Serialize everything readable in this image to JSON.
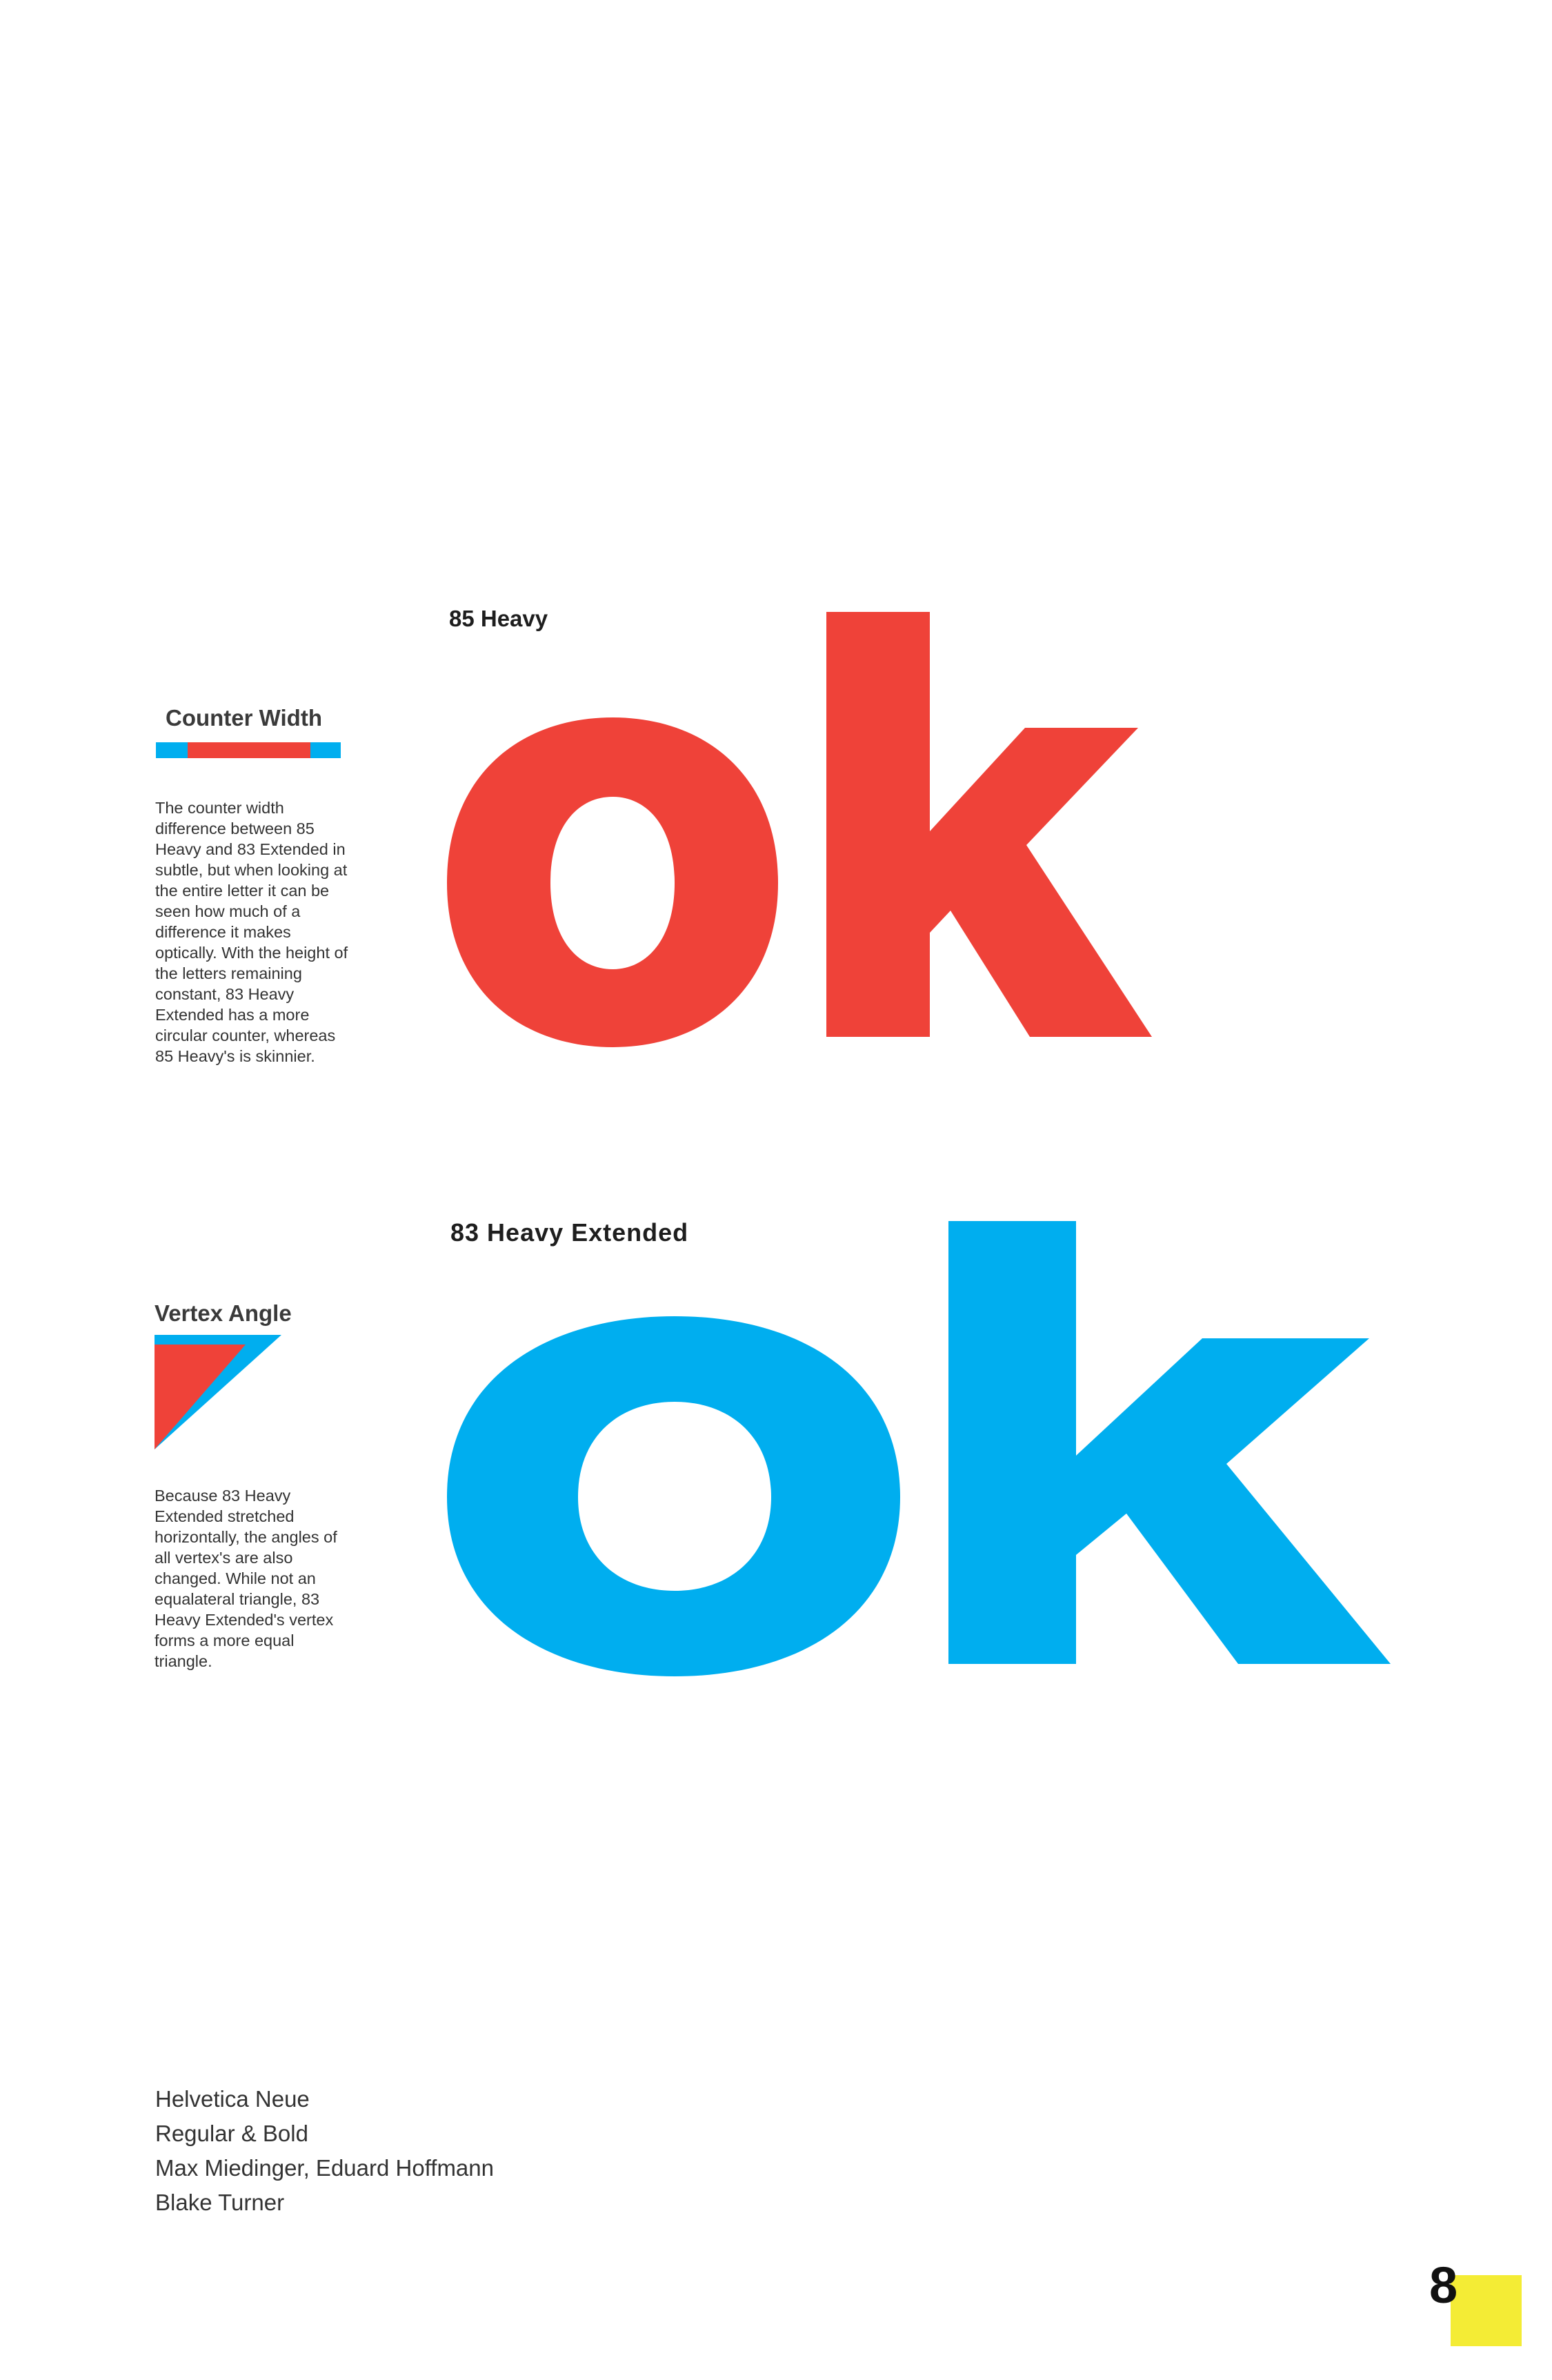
{
  "colors": {
    "red": "#ef4239",
    "blue": "#00aeef",
    "yellow": "#f4ec35",
    "background": "#ffffff"
  },
  "specimen_85": {
    "label": "85 Heavy",
    "glyphs": "ok"
  },
  "specimen_83": {
    "label": "83 Heavy Extended",
    "glyphs": "ok"
  },
  "counter_width": {
    "heading": "Counter Width",
    "body": "The counter width difference between 85 Heavy and 83 Extended in subtle, but when looking at the entire letter it can be seen how much of a difference it makes optically. With the height of the letters remaining constant, 83 Heavy Extended has a more circular counter, whereas 85 Heavy's is skinnier."
  },
  "vertex_angle": {
    "heading": "Vertex Angle",
    "body": "Because 83 Heavy Extended stretched horizontally, the angles of all vertex's are also changed. While not an equalateral triangle, 83 Heavy Extended's vertex forms a more equal triangle."
  },
  "credits": {
    "line1": "Helvetica Neue",
    "line2": "Regular & Bold",
    "line3": "Max Miedinger, Eduard Hoffmann",
    "line4": "Blake Turner"
  },
  "page": {
    "number": "8"
  }
}
